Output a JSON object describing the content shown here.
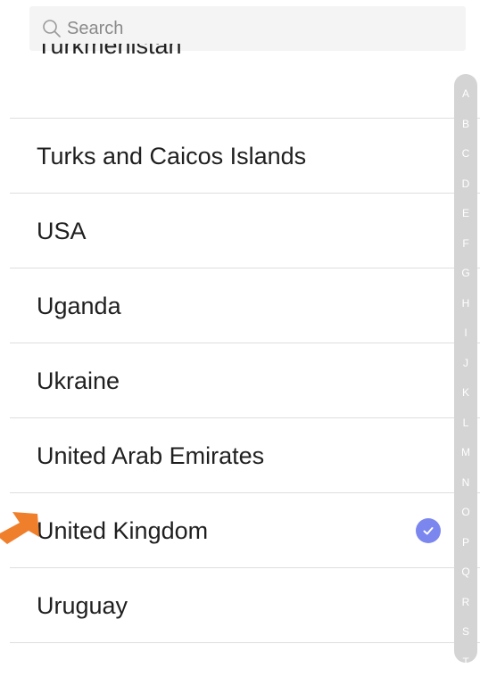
{
  "search": {
    "placeholder": "Search"
  },
  "countries": [
    {
      "name": "Turkmenistan",
      "selected": false
    },
    {
      "name": "Turks and Caicos Islands",
      "selected": false
    },
    {
      "name": "USA",
      "selected": false
    },
    {
      "name": "Uganda",
      "selected": false
    },
    {
      "name": "Ukraine",
      "selected": false
    },
    {
      "name": "United Arab Emirates",
      "selected": false
    },
    {
      "name": "United Kingdom",
      "selected": true
    },
    {
      "name": "Uruguay",
      "selected": false
    }
  ],
  "index_letters": [
    "A",
    "B",
    "C",
    "D",
    "E",
    "F",
    "G",
    "H",
    "I",
    "J",
    "K",
    "L",
    "M",
    "N",
    "O",
    "P",
    "Q",
    "R",
    "S",
    "T"
  ],
  "colors": {
    "accent": "#7b86ee",
    "pointer_arrow": "#f07f2b",
    "index_bar": "#d4d4d4"
  },
  "icons": {
    "search": "search-icon",
    "selected": "checkmark-icon",
    "pointer": "arrow-pointer-icon"
  }
}
